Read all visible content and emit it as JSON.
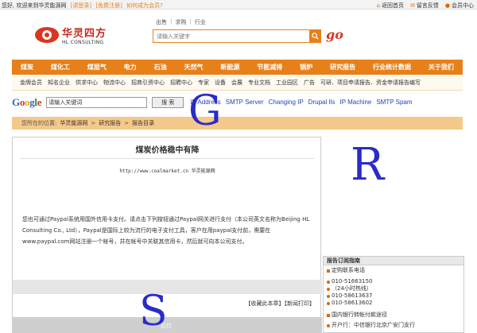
{
  "topbar": {
    "welcome": "您好, 欢迎来到华灵能源网",
    "login": "[请登录]",
    "register": "[免费注册]",
    "member": "如何成为会员?",
    "home": "返回首页",
    "feedback": "留言反馈",
    "member_center": "会员中心"
  },
  "logo": {
    "cn": "华灵四方",
    "en": "HL CONSULTING"
  },
  "search": {
    "tabs": [
      "出售",
      "求购",
      "行业"
    ],
    "placeholder": "请输入关键字",
    "go": "go"
  },
  "nav": [
    "煤炭",
    "煤化工",
    "煤层气",
    "电力",
    "石油",
    "天然气",
    "新能源",
    "节能减排",
    "锅炉",
    "研究报告",
    "行业统计数据",
    "关于我们"
  ],
  "subnav": [
    "金牌会员",
    "知名企业",
    "供求中心",
    "物流中心",
    "招商引资中心",
    "招聘中心",
    "专家",
    "设备",
    "会展",
    "专业文档",
    "工业园区",
    "广告",
    "可研、项目申请报告、资金申请报告编写"
  ],
  "google": {
    "input_value": "请输入关键词",
    "button": "搜 索",
    "links": [
      "IP Address",
      "SMTP Server",
      "Changing IP",
      "Drupal Ils",
      "IP Machine",
      "SMTP Spam"
    ]
  },
  "breadcrumb": {
    "label": "您所在的位置:",
    "items": [
      "华灵能源网",
      "研究报告",
      "报告目录"
    ]
  },
  "article": {
    "title": "煤炭价格稳中有降",
    "source": "http://www.coalmarket.cn        华灵能源网",
    "body": "您也可通过Paypal系统用国外信用卡支付。请点击下列按钮通过Paypal网关进行支付（本公司英文名称为Beijing HL Consulting Co., Ltd），Paypal是国际上较为流行的电子支付工具，客户在用paypal支付前，需要在www.paypal.com网站注册一个帐号，并在帐号中关联其信用卡，然后就可向本公司支付。",
    "tools": "【收藏此本章】【新闻打印】",
    "bottom_label": "后位"
  },
  "sidebar": {
    "title": "报告订阅指南",
    "rows": [
      "定购联系电话",
      "010-51663150",
      "（24小时热线）",
      "010-58613637",
      "010-58613602",
      "国内银行转帐付款途径",
      "开户行：中信银行北京广安门支行"
    ]
  },
  "overlay_letters": [
    "G",
    "R",
    "S"
  ]
}
